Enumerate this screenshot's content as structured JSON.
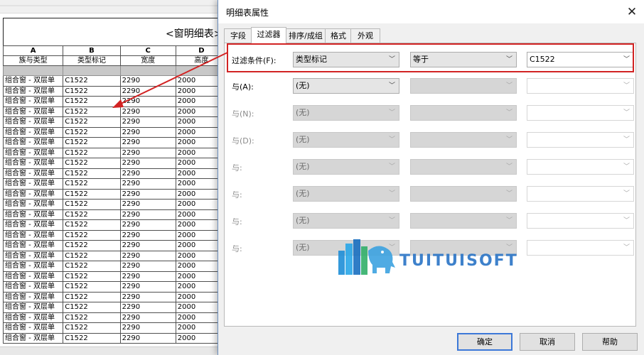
{
  "schedule": {
    "title": "<窗明细表>",
    "column_letters": [
      "A",
      "B",
      "C",
      "D"
    ],
    "column_headers": [
      "族与类型",
      "类型标记",
      "宽度",
      "高度"
    ],
    "rows": [
      [
        "组合窗 - 双层单",
        "C1522",
        "2290",
        "2000"
      ],
      [
        "组合窗 - 双层单",
        "C1522",
        "2290",
        "2000"
      ],
      [
        "组合窗 - 双层单",
        "C1522",
        "2290",
        "2000"
      ],
      [
        "组合窗 - 双层单",
        "C1522",
        "2290",
        "2000"
      ],
      [
        "组合窗 - 双层单",
        "C1522",
        "2290",
        "2000"
      ],
      [
        "组合窗 - 双层单",
        "C1522",
        "2290",
        "2000"
      ],
      [
        "组合窗 - 双层单",
        "C1522",
        "2290",
        "2000"
      ],
      [
        "组合窗 - 双层单",
        "C1522",
        "2290",
        "2000"
      ],
      [
        "组合窗 - 双层单",
        "C1522",
        "2290",
        "2000"
      ],
      [
        "组合窗 - 双层单",
        "C1522",
        "2290",
        "2000"
      ],
      [
        "组合窗 - 双层单",
        "C1522",
        "2290",
        "2000"
      ],
      [
        "组合窗 - 双层单",
        "C1522",
        "2290",
        "2000"
      ],
      [
        "组合窗 - 双层单",
        "C1522",
        "2290",
        "2000"
      ],
      [
        "组合窗 - 双层单",
        "C1522",
        "2290",
        "2000"
      ],
      [
        "组合窗 - 双层单",
        "C1522",
        "2290",
        "2000"
      ],
      [
        "组合窗 - 双层单",
        "C1522",
        "2290",
        "2000"
      ],
      [
        "组合窗 - 双层单",
        "C1522",
        "2290",
        "2000"
      ],
      [
        "组合窗 - 双层单",
        "C1522",
        "2290",
        "2000"
      ],
      [
        "组合窗 - 双层单",
        "C1522",
        "2290",
        "2000"
      ],
      [
        "组合窗 - 双层单",
        "C1522",
        "2290",
        "2000"
      ],
      [
        "组合窗 - 双层单",
        "C1522",
        "2290",
        "2000"
      ],
      [
        "组合窗 - 双层单",
        "C1522",
        "2290",
        "2000"
      ],
      [
        "组合窗 - 双层单",
        "C1522",
        "2290",
        "2000"
      ],
      [
        "组合窗 - 双层单",
        "C1522",
        "2290",
        "2000"
      ],
      [
        "组合窗 - 双层单",
        "C1522",
        "2290",
        "2000"
      ],
      [
        "组合窗 - 双层单",
        "C1522",
        "2290",
        "2000"
      ]
    ]
  },
  "dialog": {
    "title": "明细表属性",
    "close_icon": "close-icon",
    "tabs": [
      "字段",
      "过滤器",
      "排序/成组",
      "格式",
      "外观"
    ],
    "active_tab": "过滤器",
    "filters": [
      {
        "label": "过滤条件(F):",
        "field": "类型标记",
        "operator": "等于",
        "value": "C1522"
      },
      {
        "label": "与(A):",
        "field": "(无)",
        "operator": "",
        "value": ""
      },
      {
        "label": "与(N):",
        "field": "(无)",
        "operator": "",
        "value": ""
      },
      {
        "label": "与(D):",
        "field": "(无)",
        "operator": "",
        "value": ""
      },
      {
        "label": "与:",
        "field": "(无)",
        "operator": "",
        "value": ""
      },
      {
        "label": "与:",
        "field": "(无)",
        "operator": "",
        "value": ""
      },
      {
        "label": "与:",
        "field": "(无)",
        "operator": "",
        "value": ""
      },
      {
        "label": "与:",
        "field": "(无)",
        "operator": "",
        "value": ""
      }
    ],
    "buttons": {
      "ok": "确定",
      "cancel": "取消",
      "help": "帮助"
    }
  },
  "watermark": {
    "text": "TUITUISOFT",
    "logo_icon": "elephant-building-logo"
  },
  "colors": {
    "highlight": "#d22323",
    "primary_border": "#3c78d8",
    "watermark": "#2a74c6"
  }
}
